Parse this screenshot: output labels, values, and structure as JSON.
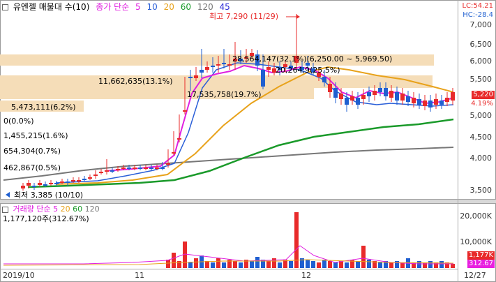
{
  "header": {
    "title": "유엔젤 매물대 수(10)",
    "ma_legend_label": "종가 단순",
    "ma_periods": [
      {
        "value": "5",
        "color": "#e020e0"
      },
      {
        "value": "10",
        "color": "#2a5fd8"
      },
      {
        "value": "20",
        "color": "#e8a21a"
      },
      {
        "value": "60",
        "color": "#1a9a2a"
      },
      {
        "value": "120",
        "color": "#777777"
      },
      {
        "value": "45",
        "color": "#2a2ad8"
      }
    ]
  },
  "top_right": {
    "lc": "LC:54.21",
    "hc": "HC:-28.4"
  },
  "annotations": {
    "high": "최고 7,290 (11/29)",
    "low": "최저 3,385 (10/10)"
  },
  "price_axis": {
    "ticks": [
      "7,000",
      "6,500",
      "6,000",
      "5,500",
      "5,000",
      "4,500",
      "4,000",
      "3,500"
    ],
    "current_price": "5,220",
    "current_change": "4.19%"
  },
  "volume_profile": [
    {
      "label": "11,662,635(13.1%)",
      "color": "#f5ddb8"
    },
    {
      "label": "17,535,758(19.7%)",
      "color": "#f5ddb8"
    },
    {
      "label": "5,473,111(6.2%)",
      "color": "#f5ddb8"
    },
    {
      "label": "0(0.0%)",
      "color": "#ffffff"
    },
    {
      "label": "1,455,215(1.6%)",
      "color": "#ffffff"
    },
    {
      "label": "654,304(0.7%)",
      "color": "#ffffff"
    },
    {
      "label": "462,867(0.5%)",
      "color": "#ffffff"
    },
    {
      "label": "28,564,147(32.1%)(6,250.00 ~ 5,969.50)",
      "color": "#f5ddb8"
    },
    {
      "label": "20,264,9(25.5%)",
      "color": "#f5ddb8"
    }
  ],
  "volume_panel": {
    "legend_title": "거래량",
    "legend_ma_label": "단순",
    "legend_periods": [
      {
        "value": "5",
        "color": "#e020e0"
      },
      {
        "value": "20",
        "color": "#e8a21a"
      },
      {
        "value": "60",
        "color": "#1a9a2a"
      },
      {
        "value": "120",
        "color": "#777777"
      }
    ],
    "current": "1,177,120주(312.67%)",
    "ticks": [
      "20,000K",
      "10,000K"
    ],
    "tag_volume": "1,177K",
    "tag_pct": "312.67"
  },
  "x_axis": {
    "ticks": [
      "2019/10",
      "11",
      "12",
      "12/27"
    ]
  },
  "colors": {
    "up": "#e82a2a",
    "down": "#1f5fd0"
  }
}
